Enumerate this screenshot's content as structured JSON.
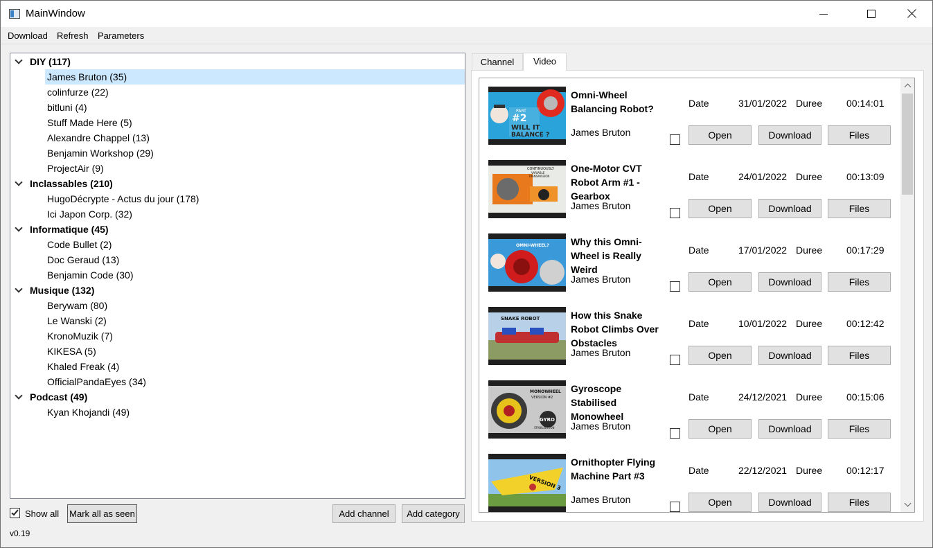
{
  "window": {
    "title": "MainWindow"
  },
  "menu": {
    "items": [
      "Download",
      "Refresh",
      "Parameters"
    ]
  },
  "tree": {
    "categories": [
      {
        "label": "DIY (117)",
        "channels": [
          "James Bruton (35)",
          "colinfurze (22)",
          "bitluni (4)",
          "Stuff Made Here (5)",
          "Alexandre Chappel (13)",
          "Benjamin Workshop (29)",
          "ProjectAir (9)"
        ]
      },
      {
        "label": "Inclassables (210)",
        "channels": [
          "HugoDécrypte - Actus du jour (178)",
          "Ici Japon Corp. (32)"
        ]
      },
      {
        "label": "Informatique (45)",
        "channels": [
          "Code Bullet (2)",
          "Doc Geraud (13)",
          "Benjamin Code (30)"
        ]
      },
      {
        "label": "Musique (132)",
        "channels": [
          "Berywam (80)",
          "Le Wanski (2)",
          "KronoMuzik (7)",
          "KIKESA (5)",
          "Khaled Freak (4)",
          "OfficialPandaEyes (34)"
        ]
      },
      {
        "label": "Podcast (49)",
        "channels": [
          "Kyan Khojandi (49)"
        ]
      }
    ],
    "selected": "James Bruton (35)"
  },
  "bottom": {
    "show_all_label": "Show all",
    "show_all_checked": true,
    "mark_all_seen": "Mark all as seen",
    "add_channel": "Add channel",
    "add_category": "Add category",
    "version": "v0.19"
  },
  "tabs": {
    "channel": "Channel",
    "video": "Video",
    "active": "Video"
  },
  "video_labels": {
    "date": "Date",
    "duration": "Duree",
    "open": "Open",
    "download": "Download",
    "files": "Files"
  },
  "videos": [
    {
      "title": "Omni-Wheel Balancing Robot?",
      "channel": "James Bruton",
      "date": "31/01/2022",
      "duration": "00:14:01",
      "thumb_text": [
        "PART",
        "#2",
        "WILL IT",
        "BALANCE ?"
      ]
    },
    {
      "title": "One-Motor CVT Robot Arm #1 - Gearbox",
      "channel": "James Bruton",
      "date": "24/01/2022",
      "duration": "00:13:09",
      "thumb_text": [
        "CONTINUOUSLY",
        "VARIABLE",
        "TRANSMISSION"
      ]
    },
    {
      "title": "Why this Omni-Wheel is Really Weird",
      "channel": "James Bruton",
      "date": "17/01/2022",
      "duration": "00:17:29",
      "thumb_text": [
        "OMNI-WHEEL?"
      ]
    },
    {
      "title": "How this Snake Robot Climbs Over  Obstacles",
      "channel": "James Bruton",
      "date": "10/01/2022",
      "duration": "00:12:42",
      "thumb_text": [
        "SNAKE ROBOT"
      ]
    },
    {
      "title": "Gyroscope Stabilised Monowheel",
      "channel": "James Bruton",
      "date": "24/12/2021",
      "duration": "00:15:06",
      "thumb_text": [
        "MONOWHEEL",
        "VERSION #2",
        "GYRO",
        "STABILISATION"
      ]
    },
    {
      "title": "Ornithopter Flying Machine Part #3",
      "channel": "James Bruton",
      "date": "22/12/2021",
      "duration": "00:12:17",
      "thumb_text": [
        "VERSION 3"
      ]
    }
  ],
  "colors": {
    "selection": "#cce8ff",
    "button": "#e1e1e1",
    "window_bg": "#f0f0f0"
  }
}
